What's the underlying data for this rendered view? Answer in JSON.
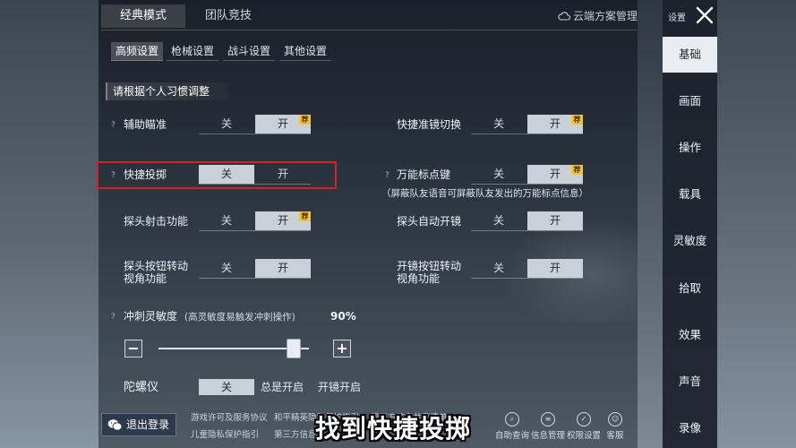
{
  "top_tabs": {
    "classic": "经典模式",
    "team": "团队竞技",
    "cloud": "云端方案管理"
  },
  "sub_tabs": [
    "高频设置",
    "枪械设置",
    "战斗设置",
    "其他设置"
  ],
  "section_head": "请根据个人习惯调整",
  "toggle_labels": {
    "off": "关",
    "on": "开",
    "rec": "荐"
  },
  "q_mark": "?",
  "settings": {
    "aim_assist": {
      "label": "辅助瞄准",
      "state": "on"
    },
    "scope_switch": {
      "label": "快捷准镜切换",
      "state": "on"
    },
    "quick_throw": {
      "label": "快捷投掷",
      "state": "off"
    },
    "marker_key": {
      "label": "万能标点键",
      "state": "on",
      "note": "（屏蔽队友语音可屏蔽队友发出的万能标点信息）"
    },
    "peek_fire": {
      "label": "探头射击功能",
      "state": "on"
    },
    "peek_auto_scope": {
      "label": "探头自动开镜",
      "state": "on"
    },
    "peek_turn_l1": "探头按钮转动",
    "peek_turn_l2": "视角功能",
    "peek_turn_state": "on",
    "scope_turn_l1": "开镜按钮转动",
    "scope_turn_l2": "视角功能",
    "scope_turn_state": "on",
    "sprint": {
      "label": "冲刺灵敏度",
      "hint": "(高灵敏度易触发冲刺操作)",
      "value": "90%",
      "level": 0.9,
      "minus": "−",
      "plus": "+"
    },
    "gyro": {
      "label": "陀螺仪",
      "options": [
        "关",
        "总是开启",
        "开镜开启"
      ],
      "selected": 0
    }
  },
  "footer": {
    "logout": "退出登录",
    "links_row1": [
      "游戏许可及服务协议",
      "和平精英隐私保护指引",
      "第三方信息共享清单"
    ],
    "links_row2": [
      "儿童隐私保护指引",
      "第三方信息"
    ],
    "icons": [
      "自助查询",
      "信息管理",
      "权限设置",
      "客服"
    ]
  },
  "subtitle": "找到快捷投掷",
  "sidebar": {
    "caption": "设置",
    "items": [
      "基础",
      "画面",
      "操作",
      "载具",
      "灵敏度",
      "拾取",
      "效果",
      "声音",
      "录像"
    ],
    "active": 0
  }
}
